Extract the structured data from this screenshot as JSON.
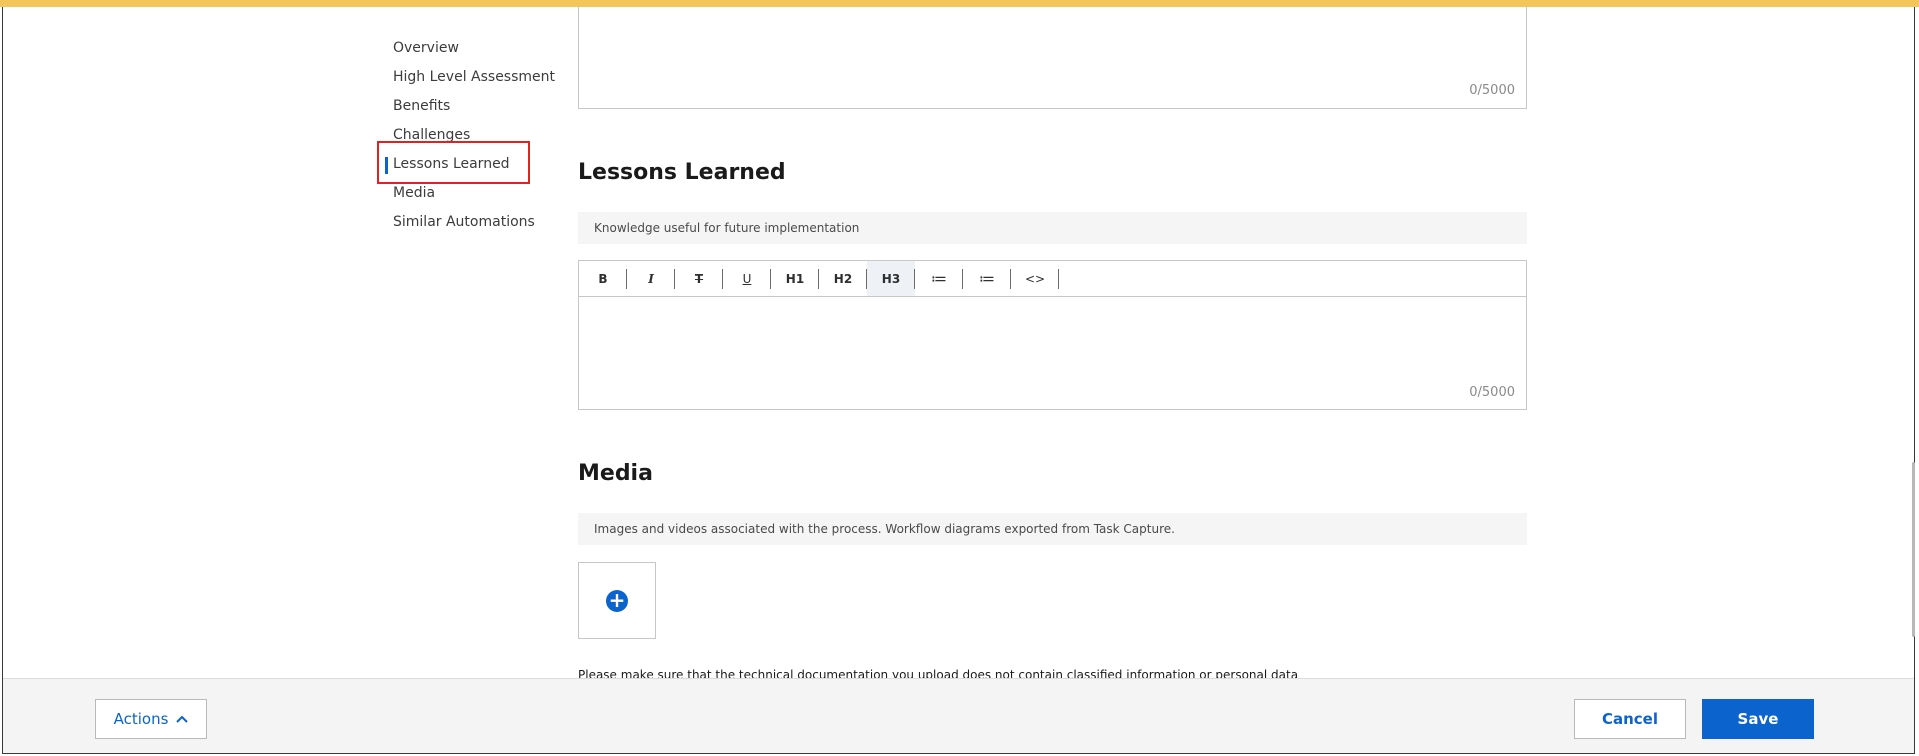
{
  "nav": {
    "items": [
      {
        "label": "Overview"
      },
      {
        "label": "High Level Assessment"
      },
      {
        "label": "Benefits"
      },
      {
        "label": "Challenges"
      },
      {
        "label": "Lessons Learned"
      },
      {
        "label": "Media"
      },
      {
        "label": "Similar Automations"
      }
    ]
  },
  "challenges_editor": {
    "counter": "0/5000"
  },
  "lessons": {
    "title": "Lessons Learned",
    "hint": "Knowledge useful for future implementation",
    "counter": "0/5000",
    "toolbar": {
      "bold": "B",
      "italic": "I",
      "strike": "T",
      "underline": "U",
      "h1": "H1",
      "h2": "H2",
      "h3": "H3",
      "bullet": "≔",
      "numbered": "≔",
      "code": "<>"
    }
  },
  "media": {
    "title": "Media",
    "hint": "Images and videos associated with the process. Workflow diagrams exported from Task Capture.",
    "add_icon": "+",
    "disclaimer": "Please make sure that the technical documentation you upload does not contain classified information or personal data"
  },
  "footer": {
    "actions_label": "Actions",
    "cancel_label": "Cancel",
    "save_label": "Save"
  },
  "colors": {
    "accent": "#0b63ce",
    "highlight": "#e32121",
    "top_bar": "#f4c65a"
  }
}
